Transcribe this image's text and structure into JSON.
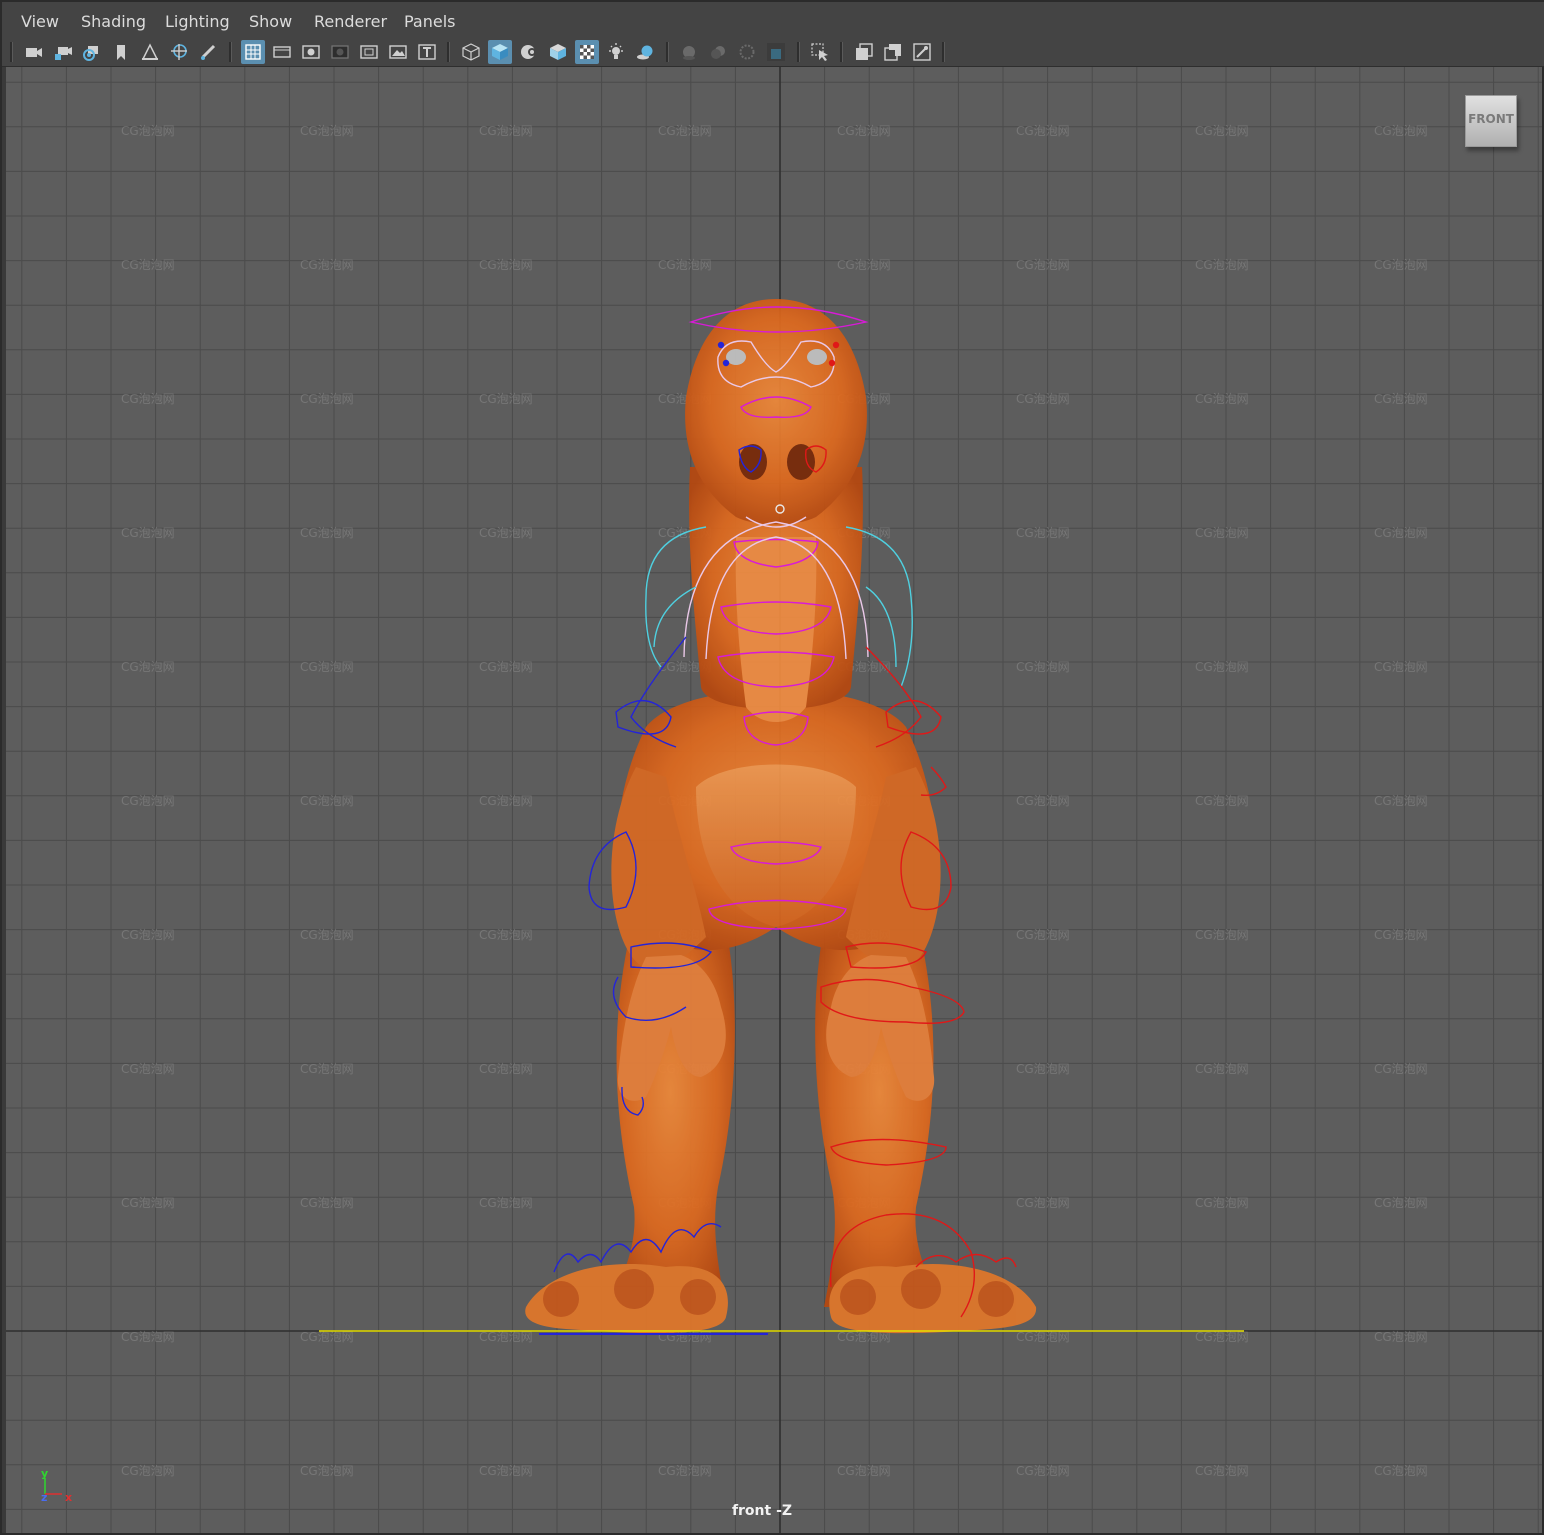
{
  "menu": [
    "View",
    "Shading",
    "Lighting",
    "Show",
    "Renderer",
    "Panels"
  ],
  "toolbar": {
    "icons": [
      "camera-icon",
      "camera-lock-icon",
      "camera-attributes-icon",
      "bookmark-icon",
      "image-plane-icon",
      "2d-pan-zoom-icon",
      "grease-pencil-icon",
      "grid-icon",
      "film-gate-icon",
      "resolution-gate-icon",
      "gate-mask-icon",
      "field-chart-icon",
      "safe-action-icon",
      "safe-title-icon",
      "wireframe-icon",
      "smooth-shade-icon",
      "wireframe-on-shaded-icon",
      "default-material-icon",
      "xray-icon",
      "use-all-lights-icon",
      "shadows-icon",
      "ambient-occlusion-icon",
      "motion-blur-icon",
      "anti-aliasing-icon",
      "depth-of-field-icon",
      "isolate-select-icon",
      "xray-joints-icon",
      "xray-active-icon",
      "viewport-renderer-icon",
      "texture-icon"
    ]
  },
  "viewport": {
    "view_cube_label": "FRONT",
    "camera_label": "front -Z",
    "watermark": "CG泡泡网",
    "axes": {
      "y": "y",
      "z": "z",
      "x": "x"
    }
  },
  "colors": {
    "menubar": "#444444",
    "viewport_bg": "#5d5d5d",
    "grid_line": "#4b4b4b",
    "grid_axis": "#2f2f2f",
    "active_button": "#5b8fb0",
    "model_orange": "#e06a1e",
    "control_left": "#2424d8",
    "control_right": "#e01818",
    "control_center": "#d81ad8",
    "control_cyan": "#4fd0e0",
    "ground_line": "#e6e000"
  }
}
